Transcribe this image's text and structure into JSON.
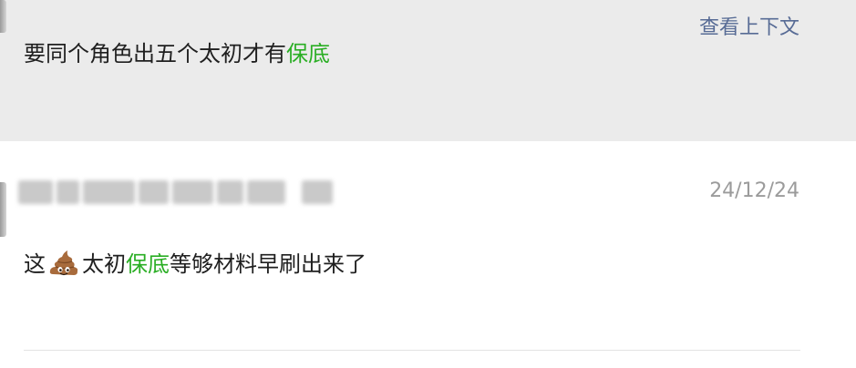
{
  "quote": {
    "context_link": "查看上下文",
    "message_pre": "要同个角色出五个太初才有",
    "message_highlight": "保底"
  },
  "comment": {
    "author": "",
    "date": "24/12/24",
    "text_pre": "这",
    "emoji": "poop-emoji",
    "text_mid": "太初",
    "text_highlight": "保底",
    "text_post": "等够材料早刷出来了"
  },
  "colors": {
    "highlight": "#2aae24",
    "link": "#576b95",
    "quote_background": "#ebebeb",
    "timestamp": "#9b9b9b"
  }
}
